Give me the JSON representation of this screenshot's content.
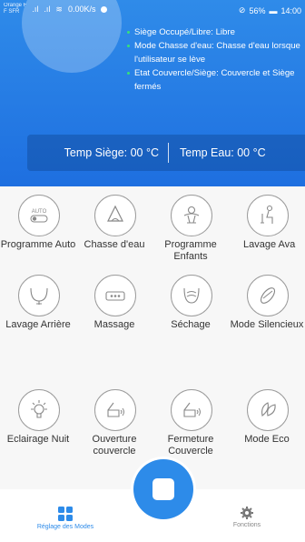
{
  "status_bar": {
    "carrier_line1": "Orange F",
    "carrier_line2": "F SFR",
    "speed": "0.00K/s",
    "battery": "56%",
    "time": "14:00"
  },
  "info": {
    "items": [
      "Siège Occupé/Libre: Libre",
      "Mode Chasse d'eau: Chasse d'eau lorsque l'utilisateur se lève",
      "Etat Couvercle/Siège: Couvercle et Siège fermés"
    ]
  },
  "temperature": {
    "seat": "Temp Siège: 00 °C",
    "water": "Temp Eau: 00 °C"
  },
  "functions": [
    {
      "label": "Programme Auto",
      "icon": "auto-toggle-icon"
    },
    {
      "label": "Chasse d'eau",
      "icon": "flush-icon"
    },
    {
      "label": "Programme Enfants",
      "icon": "children-icon"
    },
    {
      "label": "Lavage Ava",
      "icon": "front-wash-icon"
    },
    {
      "label": "Lavage Arrière",
      "icon": "rear-wash-icon"
    },
    {
      "label": "Massage",
      "icon": "massage-icon"
    },
    {
      "label": "Séchage",
      "icon": "drying-icon"
    },
    {
      "label": "Mode Silencieux",
      "icon": "silent-mode-icon"
    },
    {
      "label": "Eclairage Nuit",
      "icon": "night-light-icon"
    },
    {
      "label": "Ouverture couvercle",
      "icon": "lid-open-icon"
    },
    {
      "label": "Fermeture Couvercle",
      "icon": "lid-close-icon"
    },
    {
      "label": "Mode Eco",
      "icon": "eco-icon"
    }
  ],
  "icon_texts": {
    "auto": "AUTO"
  },
  "nav": {
    "left_label": "Réglage des Modes",
    "right_label": "Fonctions"
  },
  "colors": {
    "accent": "#2d8be9",
    "header": "#1e6fe0",
    "status_dot": "#36e07a"
  }
}
